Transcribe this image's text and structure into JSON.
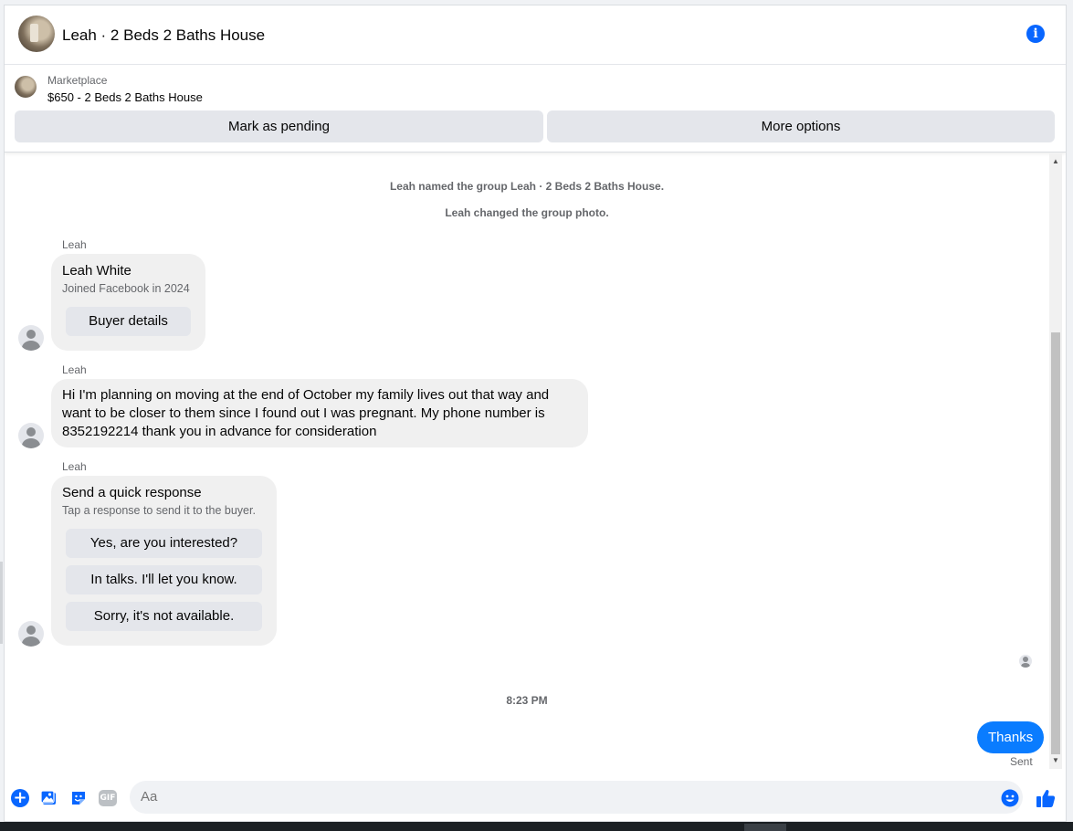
{
  "header": {
    "title": "Leah · 2 Beds 2 Baths House",
    "info_icon": "info-icon"
  },
  "marketplace": {
    "label": "Marketplace",
    "listing": "$650 - 2 Beds 2 Baths House",
    "mark_pending_label": "Mark as pending",
    "more_options_label": "More options"
  },
  "system_messages": [
    "Leah named the group Leah · 2 Beds 2 Baths House.",
    "Leah changed the group photo."
  ],
  "buyer_card": {
    "sender": "Leah",
    "name": "Leah White",
    "joined": "Joined Facebook in 2024",
    "button": "Buyer details"
  },
  "message": {
    "sender": "Leah",
    "text": "Hi I'm planning on moving at the end of October my family lives out that way and want to be closer to them since I found out I was pregnant. My phone number is 8352192214 thank you in advance for consideration"
  },
  "quick_response": {
    "sender": "Leah",
    "title": "Send a quick response",
    "subtitle": "Tap a response to send it to the buyer.",
    "options": [
      "Yes, are you interested?",
      "In talks. I'll let you know.",
      "Sorry, it's not available."
    ]
  },
  "timestamp": "8:23 PM",
  "outgoing": {
    "text": "Thanks",
    "status": "Sent"
  },
  "composer": {
    "placeholder": "Aa",
    "gif_label": "GIF"
  },
  "colors": {
    "accent": "#0866ff",
    "outgoing_bubble": "#0a7cff",
    "incoming_bubble": "#f0f0f0",
    "button_bg": "#e4e6eb",
    "secondary_text": "#65676b"
  }
}
